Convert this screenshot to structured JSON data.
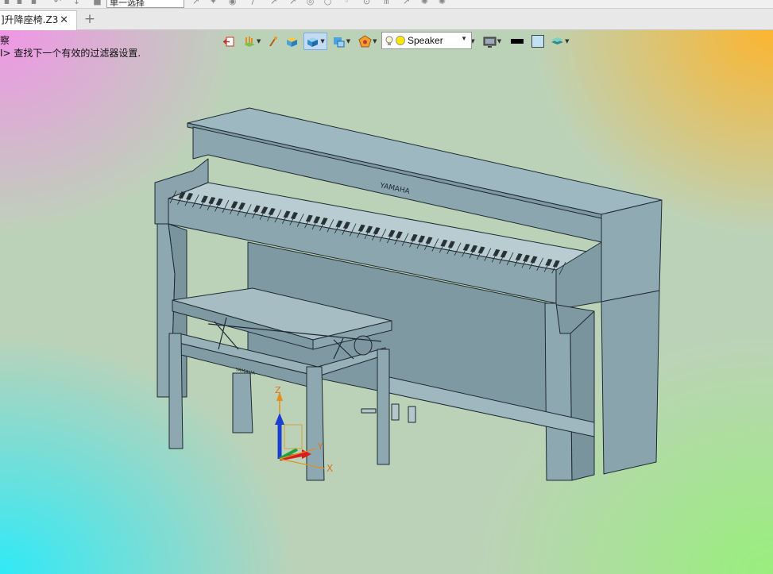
{
  "document": {
    "tab_label": "]升降座椅.Z3",
    "tab_close": "✕",
    "tab_add": "+"
  },
  "toolbar_top": {
    "filter_combo_value": "单一选择"
  },
  "messages": [
    "察",
    "I> 查找下一个有效的过滤器设置."
  ],
  "view_toolbar": {
    "light_value": "Speaker",
    "icons": [
      "exit-icon",
      "layers-icon",
      "brush-icon",
      "box-icon",
      "shaded-cube-icon",
      "display-mode-icon",
      "render-style-icon",
      "view-orient-icon",
      "zoom-icon",
      "frame-icon",
      "clip-icon",
      "screen-icon",
      "line-color-swatch",
      "bg-color-swatch",
      "layer-stack-icon"
    ]
  },
  "model": {
    "brand_text": "YAMAHA",
    "bench_brand_text": "YAMAHA"
  },
  "triad": {
    "x_label": "X",
    "y_label": "Y",
    "z_label": "Z"
  },
  "colors": {
    "model_fill": "#8fa9b3",
    "model_edge": "#1e2a30",
    "selection_highlight": "#7aaee6"
  }
}
